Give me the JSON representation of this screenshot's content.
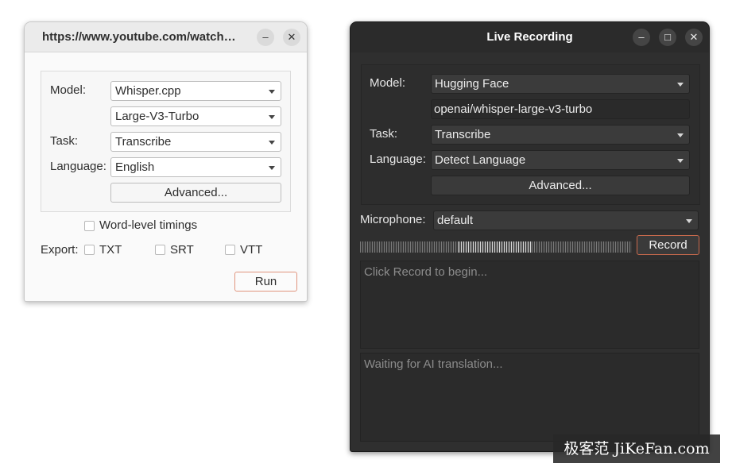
{
  "light_window": {
    "title": "https://www.youtube.com/watch…",
    "minimize_glyph": "–",
    "close_glyph": "✕",
    "model_label": "Model:",
    "model_value": "Whisper.cpp",
    "model_size_value": "Large-V3-Turbo",
    "task_label": "Task:",
    "task_value": "Transcribe",
    "language_label": "Language:",
    "language_value": "English",
    "advanced_label": "Advanced...",
    "word_level_label": "Word-level timings",
    "export_label": "Export:",
    "export_txt": "TXT",
    "export_srt": "SRT",
    "export_vtt": "VTT",
    "run_label": "Run"
  },
  "dark_window": {
    "title": "Live Recording",
    "minimize_glyph": "–",
    "maximize_glyph": "□",
    "close_glyph": "✕",
    "model_label": "Model:",
    "model_value": "Hugging Face",
    "model_id_value": "openai/whisper-large-v3-turbo",
    "task_label": "Task:",
    "task_value": "Transcribe",
    "language_label": "Language:",
    "language_value": "Detect Language",
    "advanced_label": "Advanced...",
    "microphone_label": "Microphone:",
    "microphone_value": "default",
    "record_label": "Record",
    "transcript_placeholder": "Click Record to begin...",
    "translation_placeholder": "Waiting for AI translation..."
  },
  "watermark": "极客范 JiKeFan.com",
  "colors": {
    "accent_border": "#e0957e",
    "record_border": "#c96a4d",
    "dark_bg": "#2f2f2f",
    "light_bg": "#fafafa"
  }
}
